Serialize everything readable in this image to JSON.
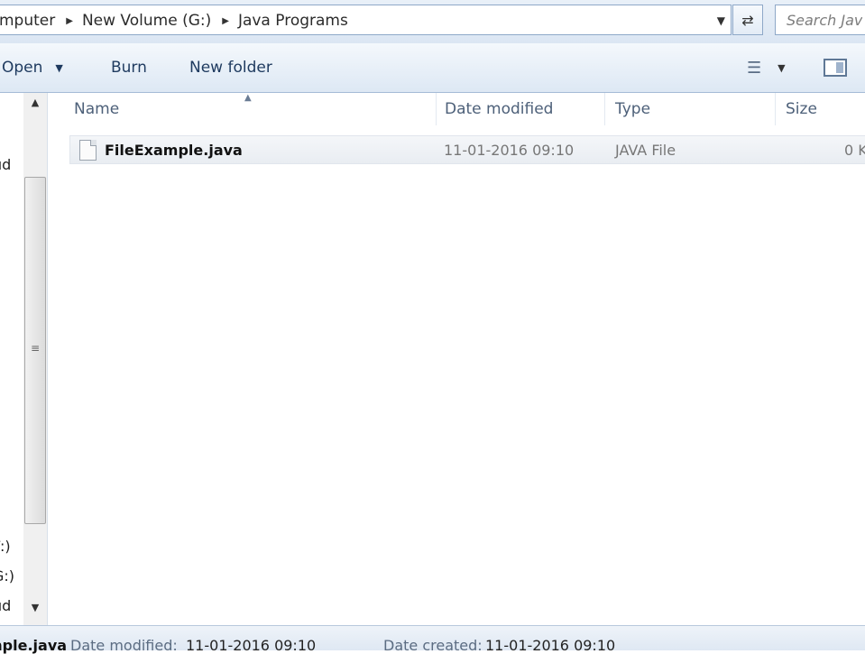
{
  "address_bar": {
    "breadcrumbs": [
      "mputer",
      "New Volume (G:)",
      "Java Programs"
    ],
    "dropdown_icon": "chevron-down-icon",
    "refresh_icon": "refresh-icon"
  },
  "search": {
    "placeholder": "Search Java Programs"
  },
  "toolbar": {
    "open_label": "Open",
    "burn_label": "Burn",
    "new_folder_label": "New folder",
    "views_icon": "details-view-icon",
    "preview_icon": "preview-pane-icon"
  },
  "nav_pane": {
    "items": [
      "ud",
      "F:)",
      "G:)",
      "ud"
    ]
  },
  "file_list": {
    "columns": [
      "Name",
      "Date modified",
      "Type",
      "Size"
    ],
    "rows": [
      {
        "name": "FileExample.java",
        "date_modified": "11-01-2016 09:10",
        "type": "JAVA File",
        "size": "0 K"
      }
    ]
  },
  "details_pane": {
    "name": "mple.java",
    "date_modified_label": "Date modified:",
    "date_modified": "11-01-2016 09:10",
    "date_created_label": "Date created:",
    "date_created": "11-01-2016 09:10"
  }
}
